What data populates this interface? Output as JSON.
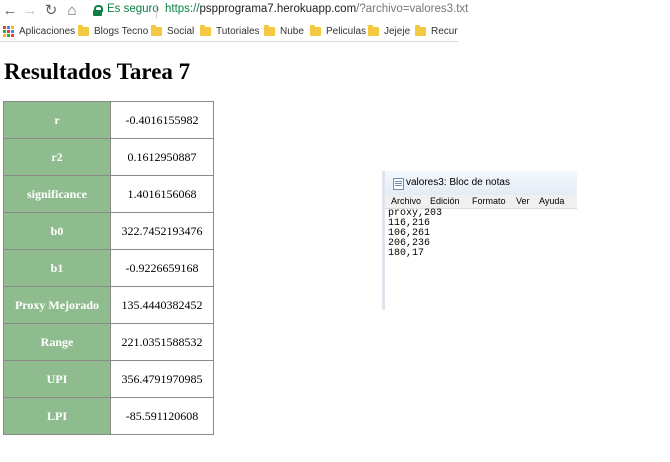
{
  "browser": {
    "secure_label": "Es seguro",
    "url_protocol": "https://",
    "url_host": "pspprograma7.herokuapp.com",
    "url_rest": "/?archivo=valores3.txt",
    "bookmarks": [
      "Aplicaciones",
      "Blogs Tecno",
      "Social",
      "Tutoriales",
      "Nube",
      "Peliculas",
      "Jejeje",
      "Recurs"
    ]
  },
  "page": {
    "title": "Resultados Tarea 7",
    "rows": [
      {
        "label": "r",
        "value": "-0.4016155982"
      },
      {
        "label": "r2",
        "value": "0.1612950887"
      },
      {
        "label": "significance",
        "value": "1.4016156068"
      },
      {
        "label": "b0",
        "value": "322.7452193476"
      },
      {
        "label": "b1",
        "value": "-0.9226659168"
      },
      {
        "label": "Proxy Mejorado",
        "value": "135.4440382452"
      },
      {
        "label": "Range",
        "value": "221.0351588532"
      },
      {
        "label": "UPI",
        "value": "356.4791970985"
      },
      {
        "label": "LPI",
        "value": "-85.591120608"
      }
    ]
  },
  "notepad": {
    "title": "valores3: Bloc de notas",
    "menu": [
      "Archivo",
      "Edición",
      "Formato",
      "Ver",
      "Ayuda"
    ],
    "lines": [
      "proxy,203",
      "116,216",
      "106,261",
      "206,236",
      "180,17"
    ]
  }
}
